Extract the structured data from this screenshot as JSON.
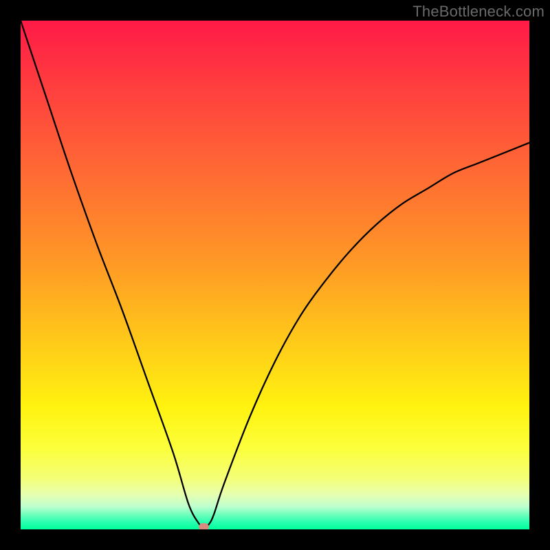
{
  "attribution": "TheBottleneck.com",
  "chart_data": {
    "type": "line",
    "title": "",
    "xlabel": "",
    "ylabel": "",
    "xlim": [
      0,
      100
    ],
    "ylim": [
      0,
      100
    ],
    "background": "rainbow-gradient-vertical",
    "series": [
      {
        "name": "bottleneck-curve",
        "x": [
          0,
          5,
          10,
          15,
          20,
          25,
          30,
          33,
          35,
          36,
          37,
          38,
          40,
          45,
          50,
          55,
          60,
          65,
          70,
          75,
          80,
          85,
          90,
          95,
          100
        ],
        "values": [
          100,
          85,
          70,
          56,
          43,
          29,
          15,
          5,
          1.2,
          0.5,
          1,
          3,
          9,
          22,
          33,
          42,
          49,
          55,
          60,
          64,
          67,
          70,
          72,
          74,
          76
        ]
      }
    ],
    "marker": {
      "x": 36,
      "y": 0.5,
      "color": "#d98b80"
    }
  }
}
